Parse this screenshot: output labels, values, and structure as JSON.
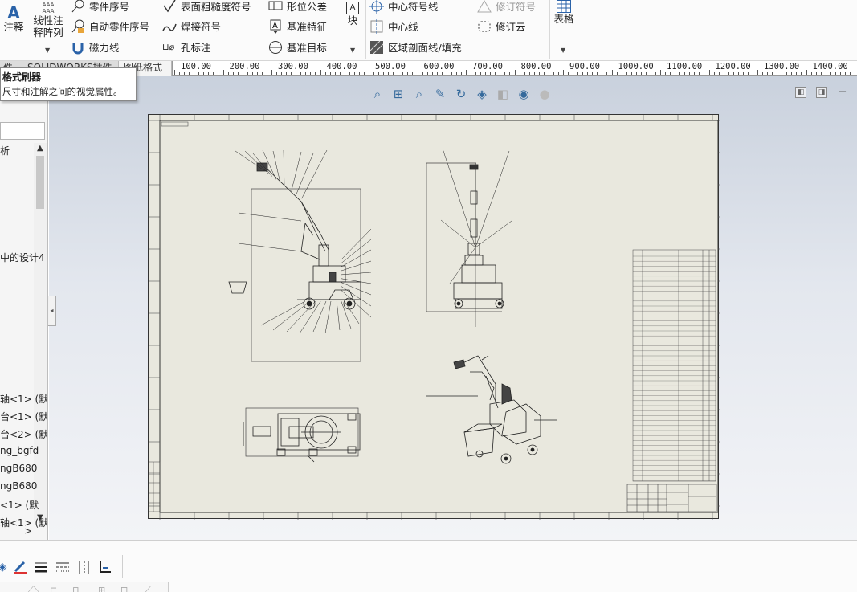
{
  "ribbon": {
    "annotation": "注释",
    "linear_pattern_line1": "线性注",
    "linear_pattern_line2": "释阵列",
    "balloon": "零件序号",
    "auto_balloon": "自动零件序号",
    "magnetic_line": "磁力线",
    "surface_finish": "表面粗糙度符号",
    "weld_symbol": "焊接符号",
    "hole_callout": "孔标注",
    "geometric_tolerance": "形位公差",
    "datum_feature": "基准特征",
    "datum_target": "基准目标",
    "block": "块",
    "center_mark": "中心符号线",
    "centerline": "中心线",
    "area_hatch": "区域剖面线/填充",
    "revision_symbol": "修订符号",
    "revision_cloud": "修订云",
    "table": "表格"
  },
  "tabs": [
    "件",
    "SOLIDWORKS插件",
    "图纸格式"
  ],
  "ruler": {
    "labels": [
      "100.00",
      "200.00",
      "300.00",
      "400.00",
      "500.00",
      "600.00",
      "700.00",
      "800.00",
      "900.00",
      "1000.00",
      "1100.00",
      "1200.00",
      "1300.00",
      "1400.00"
    ]
  },
  "tooltip": {
    "title": "格式刷器",
    "body": "尺寸和注解之间的视觉属性。"
  },
  "tree": {
    "items": [
      {
        "label": "析"
      },
      {
        "label": "中的设计4"
      },
      {
        "label": "轴<1> (默"
      },
      {
        "label": "台<1> (默"
      },
      {
        "label": "台<2> (默"
      },
      {
        "label": "ng_bgfd"
      },
      {
        "label": "ngB680"
      },
      {
        "label": "ngB680"
      },
      {
        "label": "<1> (默"
      },
      {
        "label": "轴<1> (默"
      }
    ]
  },
  "icons": {
    "annotation": "annotation-icon",
    "zoom": "zoom-to-fit-icon",
    "rotate": "rotate-icon"
  },
  "colors": {
    "sheet": "#e9e8de",
    "accent": "#356a9c"
  }
}
